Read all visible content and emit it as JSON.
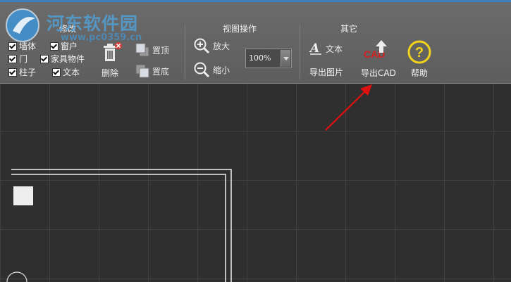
{
  "toolbar": {
    "modify": {
      "title": "修改",
      "checkboxes": [
        "墙体",
        "窗户",
        "门",
        "家具物件",
        "柱子",
        "文本"
      ],
      "delete_label": "删除",
      "top_label": "置顶",
      "bottom_label": "置底"
    },
    "view": {
      "title": "视图操作",
      "zoom_in_label": "放大",
      "zoom_out_label": "缩小",
      "zoom_value": "100%"
    },
    "other": {
      "title": "其它",
      "text_label": "文本",
      "cad_icon_text": "CAD",
      "export_image_label": "导出图片",
      "export_cad_label": "导出CAD",
      "help_label": "帮助"
    }
  },
  "watermark": {
    "site_name": "河东软件园",
    "url": "www.pc0359.cn"
  },
  "colors": {
    "ribbon": "#5d5d5d",
    "canvas": "#2f2f2f",
    "grid": "#404040",
    "help_icon": "#f2d21a",
    "arrow": "#e01010"
  }
}
